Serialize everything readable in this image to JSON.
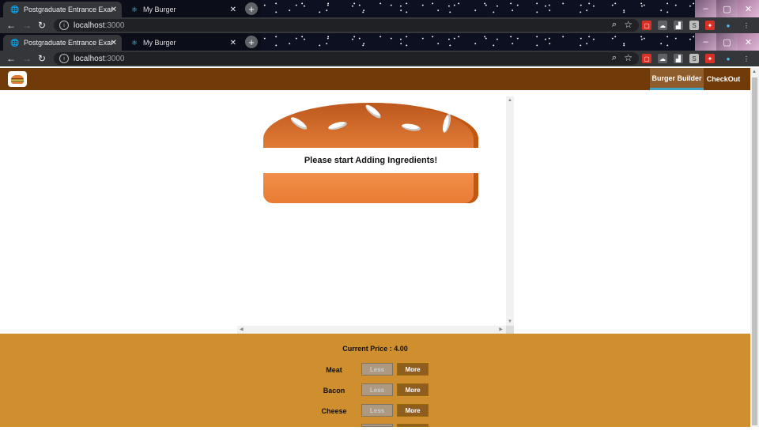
{
  "browser": {
    "tabs": [
      {
        "title": "Postgraduate Entrance Examinati...",
        "active": true,
        "favicon": "globe-icon"
      },
      {
        "title": "My Burger",
        "active": false,
        "favicon": "react-icon"
      }
    ],
    "new_tab": "+",
    "url_host": "localhost",
    "url_port": ":3000"
  },
  "app": {
    "nav": [
      {
        "label": "Burger Builder",
        "active": true
      },
      {
        "label": "CheckOut",
        "active": false
      }
    ],
    "message": "Please start Adding Ingredients!",
    "price_label": "Current Price :",
    "price_value": "4.00",
    "controls": [
      {
        "label": "Meat",
        "less": "Less",
        "more": "More"
      },
      {
        "label": "Bacon",
        "less": "Less",
        "more": "More"
      },
      {
        "label": "Cheese",
        "less": "Less",
        "more": "More"
      }
    ]
  },
  "colors": {
    "toolbar": "#703b09",
    "controls_bg": "#cf8f2e",
    "more_button": "#8f5e1e",
    "less_button": "#ac9980",
    "active_nav_border": "#40a4c8"
  }
}
